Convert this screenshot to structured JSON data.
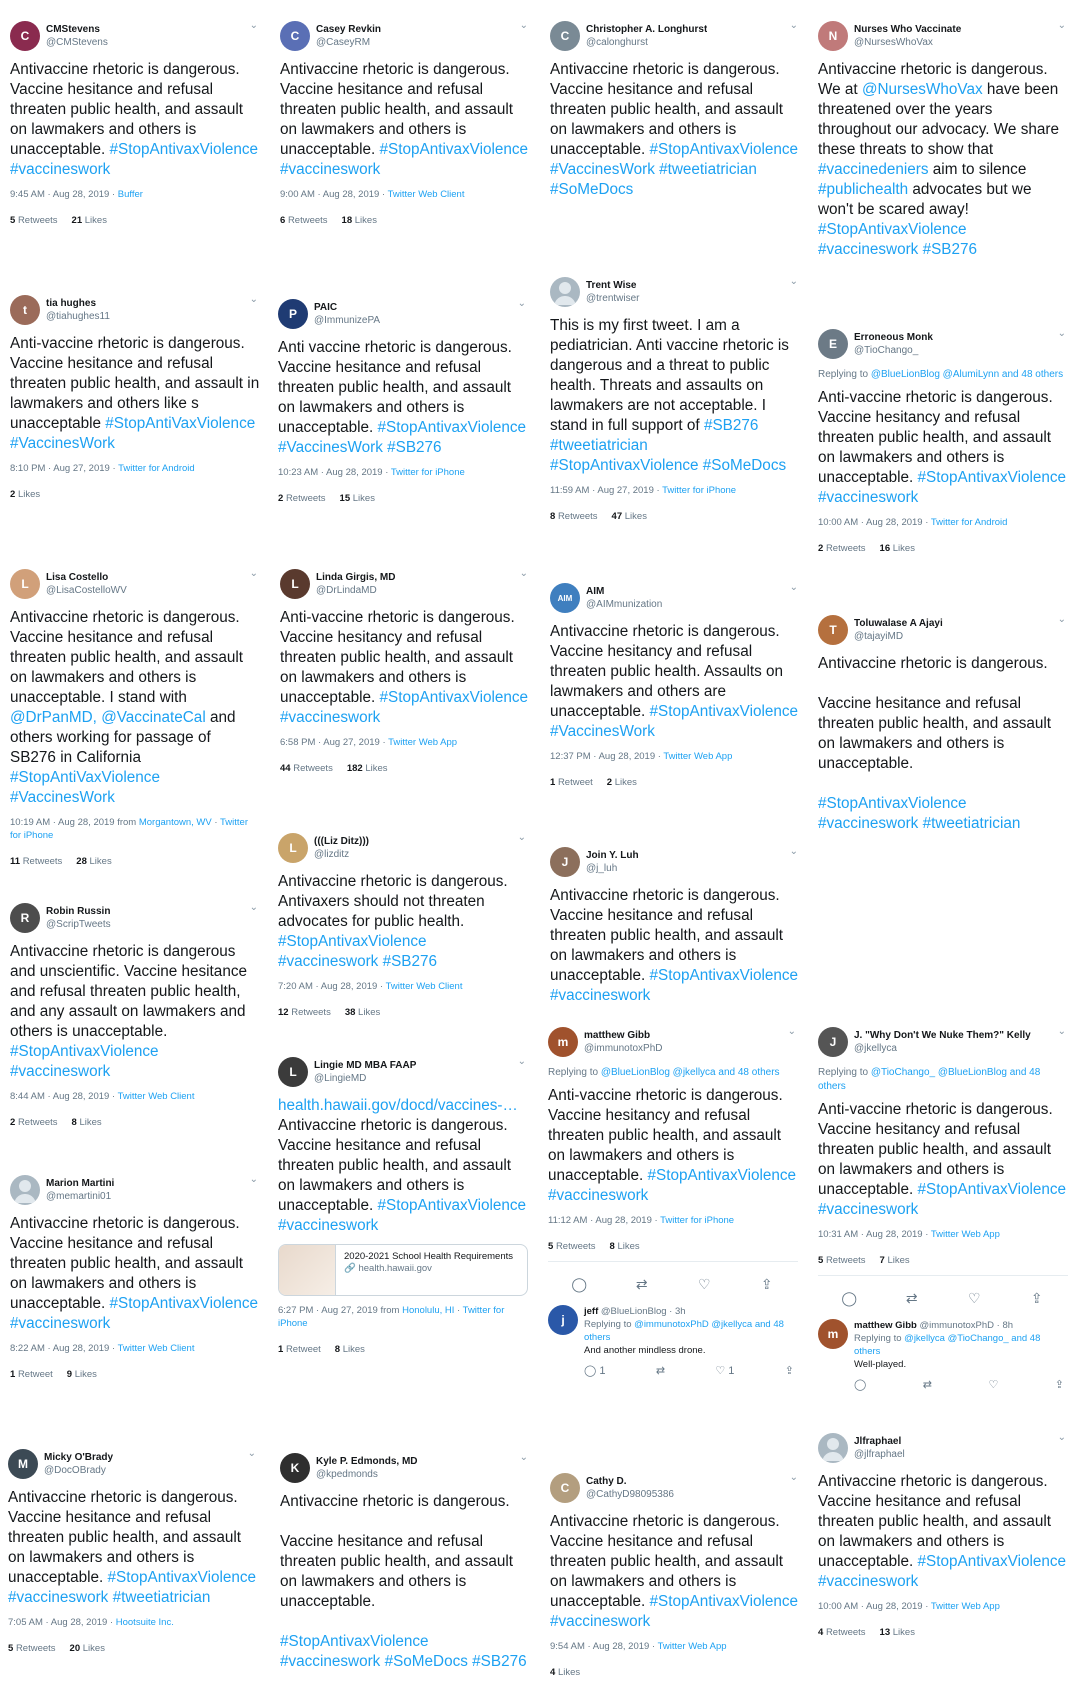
{
  "tweets": [
    {
      "name": "CMStevens",
      "handle": "@CMStevens",
      "color": "#8a2b4f",
      "initial": "C",
      "body": "Antivaccine rhetoric is dangerous. Vaccine hesitance and refusal threaten public health, and assault on lawmakers and others is unacceptable. #StopAntivaxViolence #vaccineswork",
      "time": "9:45 AM · Aug 28, 2019 · ",
      "source": "Buffer",
      "retweets": "5",
      "retweets_label": "Retweets",
      "likes": "21",
      "likes_label": "Likes"
    },
    {
      "name": "Casey Revkin",
      "handle": "@CaseyRM",
      "color": "#5a6fb5",
      "initial": "C",
      "body": "Antivaccine rhetoric is dangerous. Vaccine hesitance and refusal threaten public health, and assault on lawmakers and others is unacceptable. #StopAntivaxViolence #vaccineswork",
      "time": "9:00 AM · Aug 28, 2019 · ",
      "source": "Twitter Web Client",
      "retweets": "6",
      "retweets_label": "Retweets",
      "likes": "18",
      "likes_label": "Likes"
    },
    {
      "name": "Christopher A. Longhurst",
      "handle": "@calonghurst",
      "color": "#7a8a95",
      "initial": "C",
      "body": "Antivaccine rhetoric is dangerous. Vaccine hesitance and refusal threaten public health, and assault on lawmakers and others is unacceptable. #StopAntivaxViolence #VaccinesWork #tweetiatrician #SoMeDocs"
    },
    {
      "name": "Nurses Who Vaccinate",
      "handle": "@NursesWhoVax",
      "color": "#c07a7a",
      "initial": "N",
      "body": "Antivaccine rhetoric is dangerous. We at @NursesWhoVax have been threatened over the years throughout our advocacy. We share these threats to show that #vaccinedeniers aim to silence #publichealth advocates but we won't be scared away! #StopAntivaxViolence #vaccineswork #SB276"
    },
    {
      "name": "tia hughes",
      "handle": "@tiahughes11",
      "color": "#9b6b5a",
      "initial": "t",
      "body": "Anti-vaccine rhetoric is dangerous. Vaccine hesitance and refusal threaten public health, and assault in lawmakers and others like s unacceptable #StopAntiVaxViolence #VaccinesWork",
      "time": "8:10 PM · Aug 27, 2019 · ",
      "source": "Twitter for Android",
      "likes": "2",
      "likes_label": "Likes"
    },
    {
      "name": "PAIC",
      "handle": "@ImmunizePA",
      "color": "#1f3b73",
      "initial": "P",
      "body": "Anti vaccine rhetoric is dangerous. Vaccine hesitance and refusal threaten public health, and assault on lawmakers and others is unacceptable. #StopAntivaxViolence #VaccinesWork #SB276",
      "time": "10:23 AM · Aug 28, 2019 · ",
      "source": "Twitter for iPhone",
      "retweets": "2",
      "retweets_label": "Retweets",
      "likes": "15",
      "likes_label": "Likes"
    },
    {
      "name": "Trent Wise",
      "handle": "@trentwiser",
      "color": "#aab8c2",
      "initial": "",
      "body": "This is my first tweet. I am a pediatrician.  Anti vaccine rhetoric is dangerous and a threat to public health.  Threats and assaults on lawmakers are not acceptable.  I stand in full support of #SB276 #tweetiatrician #StopAntivaxViolence #SoMeDocs",
      "time": "11:59 AM · Aug 27, 2019 · ",
      "source": "Twitter for iPhone",
      "retweets": "8",
      "retweets_label": "Retweets",
      "likes": "47",
      "likes_label": "Likes"
    },
    {
      "name": "Erroneous Monk",
      "handle": "@TioChango_",
      "color": "#6c7a86",
      "initial": "E",
      "reply_prefix": "Replying to ",
      "reply_to": "@BlueLionBlog @AlumiLynn and 48 others",
      "body": "Anti-vaccine rhetoric is dangerous. Vaccine hesitancy and refusal threaten public health, and assault on lawmakers and others is unacceptable. #StopAntivaxViolence #vaccineswork",
      "time": "10:00 AM · Aug 28, 2019 · ",
      "source": "Twitter for Android",
      "retweets": "2",
      "retweets_label": "Retweets",
      "likes": "16",
      "likes_label": "Likes"
    },
    {
      "name": "Lisa Costello",
      "handle": "@LisaCostelloWV",
      "color": "#d1a07a",
      "initial": "L",
      "body": "Antivaccine rhetoric is dangerous. Vaccine hesitance and refusal threaten public health, and assault on lawmakers and others is unacceptable. I stand with @DrPanMD, @VaccinateCal and others working for passage of SB276 in California #StopAntiVaxViolence #VaccinesWork",
      "time": "10:19 AM · Aug 28, 2019 from ",
      "time_place": "Morgantown, WV",
      "source_prefix": " · ",
      "source": "Twitter for iPhone",
      "retweets": "11",
      "retweets_label": "Retweets",
      "likes": "28",
      "likes_label": "Likes"
    },
    {
      "name": "Linda Girgis, MD",
      "handle": "@DrLindaMD",
      "color": "#5a3a2e",
      "initial": "L",
      "body": "Anti-vaccine rhetoric is dangerous. Vaccine hesitancy and refusal threaten public health, and assault on lawmakers and others is unacceptable. #StopAntivaxViolence #vaccineswork",
      "time": "6:58 PM · Aug 27, 2019 · ",
      "source": "Twitter Web App",
      "retweets": "44",
      "retweets_label": "Retweets",
      "likes": "182",
      "likes_label": "Likes"
    },
    {
      "name": "AIM",
      "handle": "@AIMmunization",
      "color": "#3f7fbf",
      "initial": "AIM",
      "body": "Antivaccine rhetoric is dangerous. Vaccine hesitancy and refusal threaten public health. Assaults on lawmakers and others are unacceptable. #StopAntivaxViolence #VaccinesWork",
      "time": "12:37 PM · Aug 28, 2019 · ",
      "source": "Twitter Web App",
      "retweets": "1",
      "retweets_label": "Retweet",
      "likes": "2",
      "likes_label": "Likes"
    },
    {
      "name": "Toluwalase A Ajayi",
      "handle": "@tajayiMD",
      "color": "#b5703e",
      "initial": "T",
      "body": "Antivaccine rhetoric is dangerous.\n\nVaccine hesitance and refusal threaten public health, and assault on lawmakers and others is unacceptable.\n\n#StopAntivaxViolence #vaccineswork #tweetiatrician"
    },
    {
      "name": "(((Liz Ditz)))",
      "handle": "@lizditz",
      "color": "#c9a46a",
      "initial": "L",
      "body": "Antivaccine rhetoric is dangerous. Antivaxers should not threaten advocates for public health. #StopAntivaxViolence #vaccineswork #SB276",
      "time": "7:20 AM · Aug 28, 2019 · ",
      "source": "Twitter Web Client",
      "retweets": "12",
      "retweets_label": "Retweets",
      "likes": "38",
      "likes_label": "Likes"
    },
    {
      "name": "Join Y. Luh",
      "handle": "@j_luh",
      "color": "#8c6f5c",
      "initial": "J",
      "body": "Antivaccine rhetoric is dangerous. Vaccine hesitance and refusal threaten public health, and assault on lawmakers and others is unacceptable. #StopAntivaxViolence #vaccineswork"
    },
    {
      "name": "Robin Russin",
      "handle": "@ScripTweets",
      "color": "#4d4d4d",
      "initial": "R",
      "body": "Antivaccine rhetoric is dangerous and unscientific. Vaccine hesitance and refusal threaten public health, and any assault on lawmakers and others is unacceptable. #StopAntivaxViolence #vaccineswork",
      "time": "8:44 AM · Aug 28, 2019 · ",
      "source": "Twitter Web Client",
      "retweets": "2",
      "retweets_label": "Retweets",
      "likes": "8",
      "likes_label": "Likes"
    },
    {
      "name": "Lingie MD MBA FAAP",
      "handle": "@LingieMD",
      "color": "#3b3b3b",
      "initial": "L",
      "link": "health.hawaii.gov/docd/vaccines-…",
      "body": "Antivaccine rhetoric is dangerous. Vaccine hesitance and refusal threaten public health, and assault on lawmakers and others is unacceptable. #StopAntivaxViolence #vaccineswork",
      "card_title": "2020-2021 School Health Requirements",
      "card_domain": "🔗 health.hawaii.gov",
      "time": "6:27 PM · Aug 27, 2019 from ",
      "time_place": "Honolulu, HI",
      "source_prefix": " · ",
      "source": "Twitter for iPhone",
      "retweets": "1",
      "retweets_label": "Retweet",
      "likes": "8",
      "likes_label": "Likes"
    },
    {
      "name": "matthew Gibb",
      "handle": "@immunotoxPhD",
      "color": "#a0522d",
      "initial": "m",
      "reply_prefix": "Replying to ",
      "reply_to": "@BlueLionBlog @jkellyca and 48 others",
      "body": "Anti-vaccine rhetoric is dangerous. Vaccine hesitancy and refusal threaten public health, and assault on lawmakers and others is unacceptable. #StopAntivaxViolence #vaccineswork",
      "time": "11:12 AM · Aug 28, 2019 · ",
      "source": "Twitter for iPhone",
      "retweets": "5",
      "retweets_label": "Retweets",
      "likes": "8",
      "likes_label": "Likes",
      "sub": {
        "name": "jeff",
        "handle": "@BlueLionBlog · 3h",
        "reply_prefix": "Replying to ",
        "reply_to": "@immunotoxPhD @jkellyca and 48 others",
        "text": "And another mindless drone.",
        "rt": "1",
        "lk": "1",
        "color": "#2a58a8"
      }
    },
    {
      "name": "J. \"Why Don't We Nuke Them?\" Kelly",
      "handle": "@jkellyca",
      "color": "#555555",
      "initial": "J",
      "reply_prefix": "Replying to ",
      "reply_to": "@TioChango_ @BlueLionBlog and 48 others",
      "body": "Anti-vaccine rhetoric is dangerous. Vaccine hesitancy and refusal threaten public health, and assault on lawmakers and others is unacceptable. #StopAntivaxViolence #vaccineswork",
      "time": "10:31 AM · Aug 28, 2019 · ",
      "source": "Twitter Web App",
      "retweets": "5",
      "retweets_label": "Retweets",
      "likes": "7",
      "likes_label": "Likes",
      "sub": {
        "name": "matthew Gibb",
        "handle": "@immunotoxPhD · 8h",
        "reply_prefix": "Replying to ",
        "reply_to": "@jkellyca @TioChango_ and 48 others",
        "text": "Well-played.",
        "rt": "",
        "lk": "",
        "color": "#a0522d"
      }
    },
    {
      "name": "Marion Martini",
      "handle": "@memartini01",
      "color": "#aab8c2",
      "initial": "",
      "body": "Antivaccine rhetoric is dangerous. Vaccine hesitance and refusal threaten public health, and assault on lawmakers and others is unacceptable. #StopAntivaxViolence #vaccineswork",
      "time": "8:22 AM · Aug 28, 2019 · ",
      "source": "Twitter Web Client",
      "retweets": "1",
      "retweets_label": "Retweet",
      "likes": "9",
      "likes_label": "Likes"
    },
    {
      "name": "Micky O'Brady",
      "handle": "@DocOBrady",
      "color": "#3c4a55",
      "initial": "M",
      "body": "Antivaccine rhetoric is dangerous. Vaccine hesitance and refusal threaten public health, and assault on lawmakers and others is unacceptable. #StopAntivaxViolence #vaccineswork #tweetiatrician",
      "time": "7:05 AM · Aug 28, 2019 · ",
      "source": "Hootsuite Inc.",
      "retweets": "5",
      "retweets_label": "Retweets",
      "likes": "20",
      "likes_label": "Likes"
    },
    {
      "name": "Kyle P. Edmonds, MD",
      "handle": "@kpedmonds",
      "color": "#2f2f2f",
      "initial": "K",
      "body": "Antivaccine rhetoric is dangerous.\n\nVaccine hesitance and refusal threaten public health, and assault on lawmakers and others is unacceptable.\n\n#StopAntivaxViolence #vaccineswork #SoMeDocs #SB276"
    },
    {
      "name": "Cathy D.",
      "handle": "@CathyD98095386",
      "color": "#b39e7f",
      "initial": "C",
      "body": "Antivaccine rhetoric is dangerous. Vaccine hesitance and refusal threaten public health, and assault on lawmakers and others is unacceptable. #StopAntivaxViolence #vaccineswork",
      "time": "9:54 AM · Aug 28, 2019 · ",
      "source": "Twitter Web App",
      "likes": "4",
      "likes_label": "Likes"
    },
    {
      "name": "Jlfraphael",
      "handle": "@jlfraphael",
      "color": "#aab8c2",
      "initial": "",
      "body": "Antivaccine rhetoric is dangerous. Vaccine hesitance and refusal threaten public health, and assault on lawmakers and others is unacceptable. #StopAntivaxViolence #vaccineswork",
      "time": "10:00 AM · Aug 28, 2019 · ",
      "source": "Twitter Web App",
      "retweets": "4",
      "retweets_label": "Retweets",
      "likes": "13",
      "likes_label": "Likes"
    }
  ],
  "icons": {
    "chevron": "chevron-down-icon",
    "reply": "reply-icon",
    "retweet": "retweet-icon",
    "like": "heart-icon",
    "share": "share-icon"
  },
  "colors": {
    "link": "#1da1f2",
    "muted": "#657786",
    "text": "#14171a"
  }
}
